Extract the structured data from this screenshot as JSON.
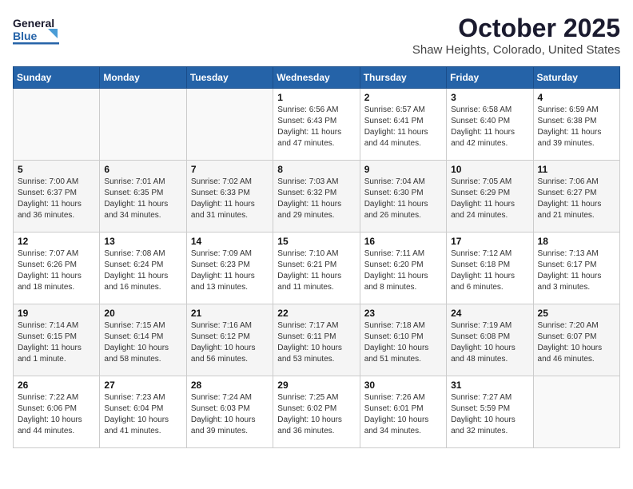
{
  "header": {
    "logo_general": "General",
    "logo_blue": "Blue",
    "month": "October 2025",
    "location": "Shaw Heights, Colorado, United States"
  },
  "weekdays": [
    "Sunday",
    "Monday",
    "Tuesday",
    "Wednesday",
    "Thursday",
    "Friday",
    "Saturday"
  ],
  "weeks": [
    [
      {
        "day": "",
        "info": ""
      },
      {
        "day": "",
        "info": ""
      },
      {
        "day": "",
        "info": ""
      },
      {
        "day": "1",
        "info": "Sunrise: 6:56 AM\nSunset: 6:43 PM\nDaylight: 11 hours\nand 47 minutes."
      },
      {
        "day": "2",
        "info": "Sunrise: 6:57 AM\nSunset: 6:41 PM\nDaylight: 11 hours\nand 44 minutes."
      },
      {
        "day": "3",
        "info": "Sunrise: 6:58 AM\nSunset: 6:40 PM\nDaylight: 11 hours\nand 42 minutes."
      },
      {
        "day": "4",
        "info": "Sunrise: 6:59 AM\nSunset: 6:38 PM\nDaylight: 11 hours\nand 39 minutes."
      }
    ],
    [
      {
        "day": "5",
        "info": "Sunrise: 7:00 AM\nSunset: 6:37 PM\nDaylight: 11 hours\nand 36 minutes."
      },
      {
        "day": "6",
        "info": "Sunrise: 7:01 AM\nSunset: 6:35 PM\nDaylight: 11 hours\nand 34 minutes."
      },
      {
        "day": "7",
        "info": "Sunrise: 7:02 AM\nSunset: 6:33 PM\nDaylight: 11 hours\nand 31 minutes."
      },
      {
        "day": "8",
        "info": "Sunrise: 7:03 AM\nSunset: 6:32 PM\nDaylight: 11 hours\nand 29 minutes."
      },
      {
        "day": "9",
        "info": "Sunrise: 7:04 AM\nSunset: 6:30 PM\nDaylight: 11 hours\nand 26 minutes."
      },
      {
        "day": "10",
        "info": "Sunrise: 7:05 AM\nSunset: 6:29 PM\nDaylight: 11 hours\nand 24 minutes."
      },
      {
        "day": "11",
        "info": "Sunrise: 7:06 AM\nSunset: 6:27 PM\nDaylight: 11 hours\nand 21 minutes."
      }
    ],
    [
      {
        "day": "12",
        "info": "Sunrise: 7:07 AM\nSunset: 6:26 PM\nDaylight: 11 hours\nand 18 minutes."
      },
      {
        "day": "13",
        "info": "Sunrise: 7:08 AM\nSunset: 6:24 PM\nDaylight: 11 hours\nand 16 minutes."
      },
      {
        "day": "14",
        "info": "Sunrise: 7:09 AM\nSunset: 6:23 PM\nDaylight: 11 hours\nand 13 minutes."
      },
      {
        "day": "15",
        "info": "Sunrise: 7:10 AM\nSunset: 6:21 PM\nDaylight: 11 hours\nand 11 minutes."
      },
      {
        "day": "16",
        "info": "Sunrise: 7:11 AM\nSunset: 6:20 PM\nDaylight: 11 hours\nand 8 minutes."
      },
      {
        "day": "17",
        "info": "Sunrise: 7:12 AM\nSunset: 6:18 PM\nDaylight: 11 hours\nand 6 minutes."
      },
      {
        "day": "18",
        "info": "Sunrise: 7:13 AM\nSunset: 6:17 PM\nDaylight: 11 hours\nand 3 minutes."
      }
    ],
    [
      {
        "day": "19",
        "info": "Sunrise: 7:14 AM\nSunset: 6:15 PM\nDaylight: 11 hours\nand 1 minute."
      },
      {
        "day": "20",
        "info": "Sunrise: 7:15 AM\nSunset: 6:14 PM\nDaylight: 10 hours\nand 58 minutes."
      },
      {
        "day": "21",
        "info": "Sunrise: 7:16 AM\nSunset: 6:12 PM\nDaylight: 10 hours\nand 56 minutes."
      },
      {
        "day": "22",
        "info": "Sunrise: 7:17 AM\nSunset: 6:11 PM\nDaylight: 10 hours\nand 53 minutes."
      },
      {
        "day": "23",
        "info": "Sunrise: 7:18 AM\nSunset: 6:10 PM\nDaylight: 10 hours\nand 51 minutes."
      },
      {
        "day": "24",
        "info": "Sunrise: 7:19 AM\nSunset: 6:08 PM\nDaylight: 10 hours\nand 48 minutes."
      },
      {
        "day": "25",
        "info": "Sunrise: 7:20 AM\nSunset: 6:07 PM\nDaylight: 10 hours\nand 46 minutes."
      }
    ],
    [
      {
        "day": "26",
        "info": "Sunrise: 7:22 AM\nSunset: 6:06 PM\nDaylight: 10 hours\nand 44 minutes."
      },
      {
        "day": "27",
        "info": "Sunrise: 7:23 AM\nSunset: 6:04 PM\nDaylight: 10 hours\nand 41 minutes."
      },
      {
        "day": "28",
        "info": "Sunrise: 7:24 AM\nSunset: 6:03 PM\nDaylight: 10 hours\nand 39 minutes."
      },
      {
        "day": "29",
        "info": "Sunrise: 7:25 AM\nSunset: 6:02 PM\nDaylight: 10 hours\nand 36 minutes."
      },
      {
        "day": "30",
        "info": "Sunrise: 7:26 AM\nSunset: 6:01 PM\nDaylight: 10 hours\nand 34 minutes."
      },
      {
        "day": "31",
        "info": "Sunrise: 7:27 AM\nSunset: 5:59 PM\nDaylight: 10 hours\nand 32 minutes."
      },
      {
        "day": "",
        "info": ""
      }
    ]
  ]
}
